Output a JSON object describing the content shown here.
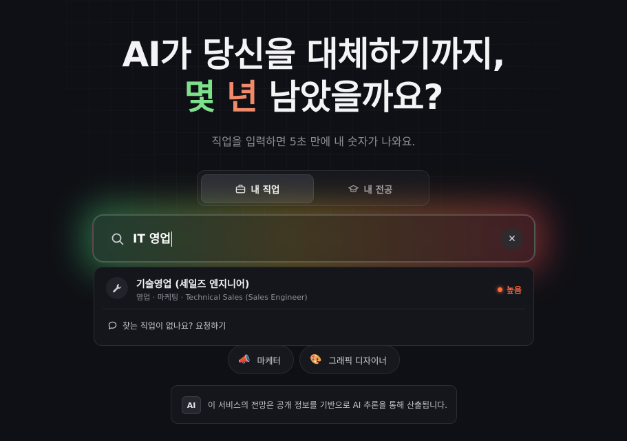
{
  "headline": {
    "line1": "AI가 당신을 대체하기까지,",
    "highlight1": "몇",
    "highlight2": "년",
    "line2_rest": "남았을까요?"
  },
  "subtitle": "직업을 입력하면 5초 만에 내 숫자가 나와요.",
  "tabs": [
    {
      "label": "내 직업",
      "icon": "briefcase-icon",
      "active": true
    },
    {
      "label": "내 전공",
      "icon": "graduation-cap-icon",
      "active": false
    }
  ],
  "search": {
    "value": "IT 영업",
    "icon": "search-icon",
    "clear_label": "✕"
  },
  "results": [
    {
      "icon": "wrench-icon",
      "title": "기술영업 (세일즈 엔지니어)",
      "meta": "영업 · 마케팅 · Technical Sales (Sales Engineer)",
      "level": "높음"
    }
  ],
  "request_link": "찾는 직업이 없나요? 요청하기",
  "suggestions": [
    {
      "label": "마케터",
      "emoji": "📣"
    },
    {
      "label": "그래픽 디자이너",
      "emoji": "🎨"
    }
  ],
  "notice": {
    "badge": "AI",
    "text": "이 서비스의 전망은 공개 정보를 기반으로 AI 추론을 통해 산출됩니다."
  },
  "colors": {
    "background": "#0f1015",
    "accent_green": "#7ee08a",
    "accent_orange": "#f08a6a",
    "level_high": "#ff6a3d"
  }
}
